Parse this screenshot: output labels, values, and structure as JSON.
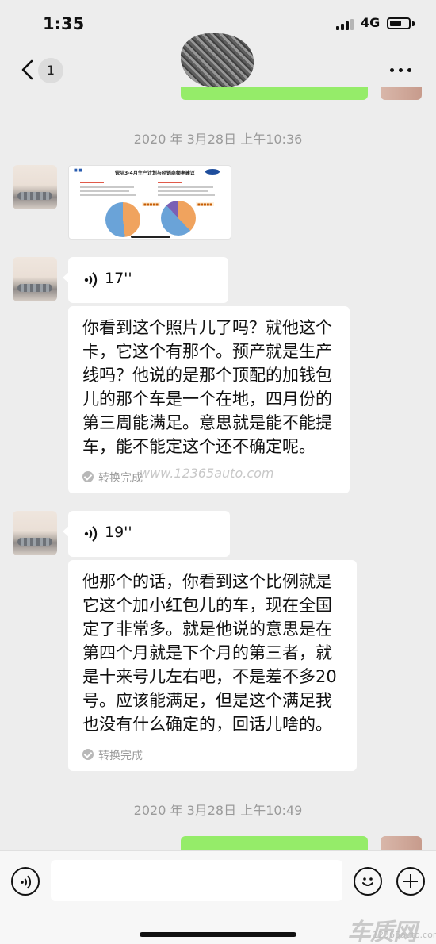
{
  "status_bar": {
    "time": "1:35",
    "network": "4G"
  },
  "nav": {
    "unread_count": "1"
  },
  "dividers": {
    "first": "2020 年 3月28日 上午10:36",
    "second": "2020 年 3月28日 上午10:49"
  },
  "image_message": {
    "header_title": "锐际3-4月生产计划与经销商频率建议"
  },
  "messages": [
    {
      "voice_duration": "17''",
      "transcript": "你看到这个照片儿了吗？就他这个卡，它这个有那个。预产就是生产线吗？他说的是那个顶配的加钱包儿的那个车是一个在地，四月份的第三周能满足。意思就是能不能提车，能不能定这个还不确定呢。",
      "status": "转换完成"
    },
    {
      "voice_duration": "19''",
      "transcript": "他那个的话，你看到这个比例就是它这个加小红包儿的车，现在全国定了非常多。就是他说的意思是在第四个月就是下个月的第三者，就是十来号儿左右吧，不是差不多20号。应该能满足，但是这个满足我也没有什么确定的，回话儿啥的。",
      "status": "转换完成"
    }
  ],
  "watermark": {
    "mid": "www.12365auto.com",
    "corner_logo": "车质网",
    "corner_url": "12365auto.com"
  },
  "colors": {
    "chat_bg": "#ededed",
    "bubble_green": "#95ec69",
    "bubble_white": "#ffffff",
    "muted_text": "#9a9a9a"
  },
  "icons": [
    "back-icon",
    "more-icon",
    "voice-wave-icon",
    "check-icon",
    "emoji-icon",
    "plus-icon"
  ]
}
